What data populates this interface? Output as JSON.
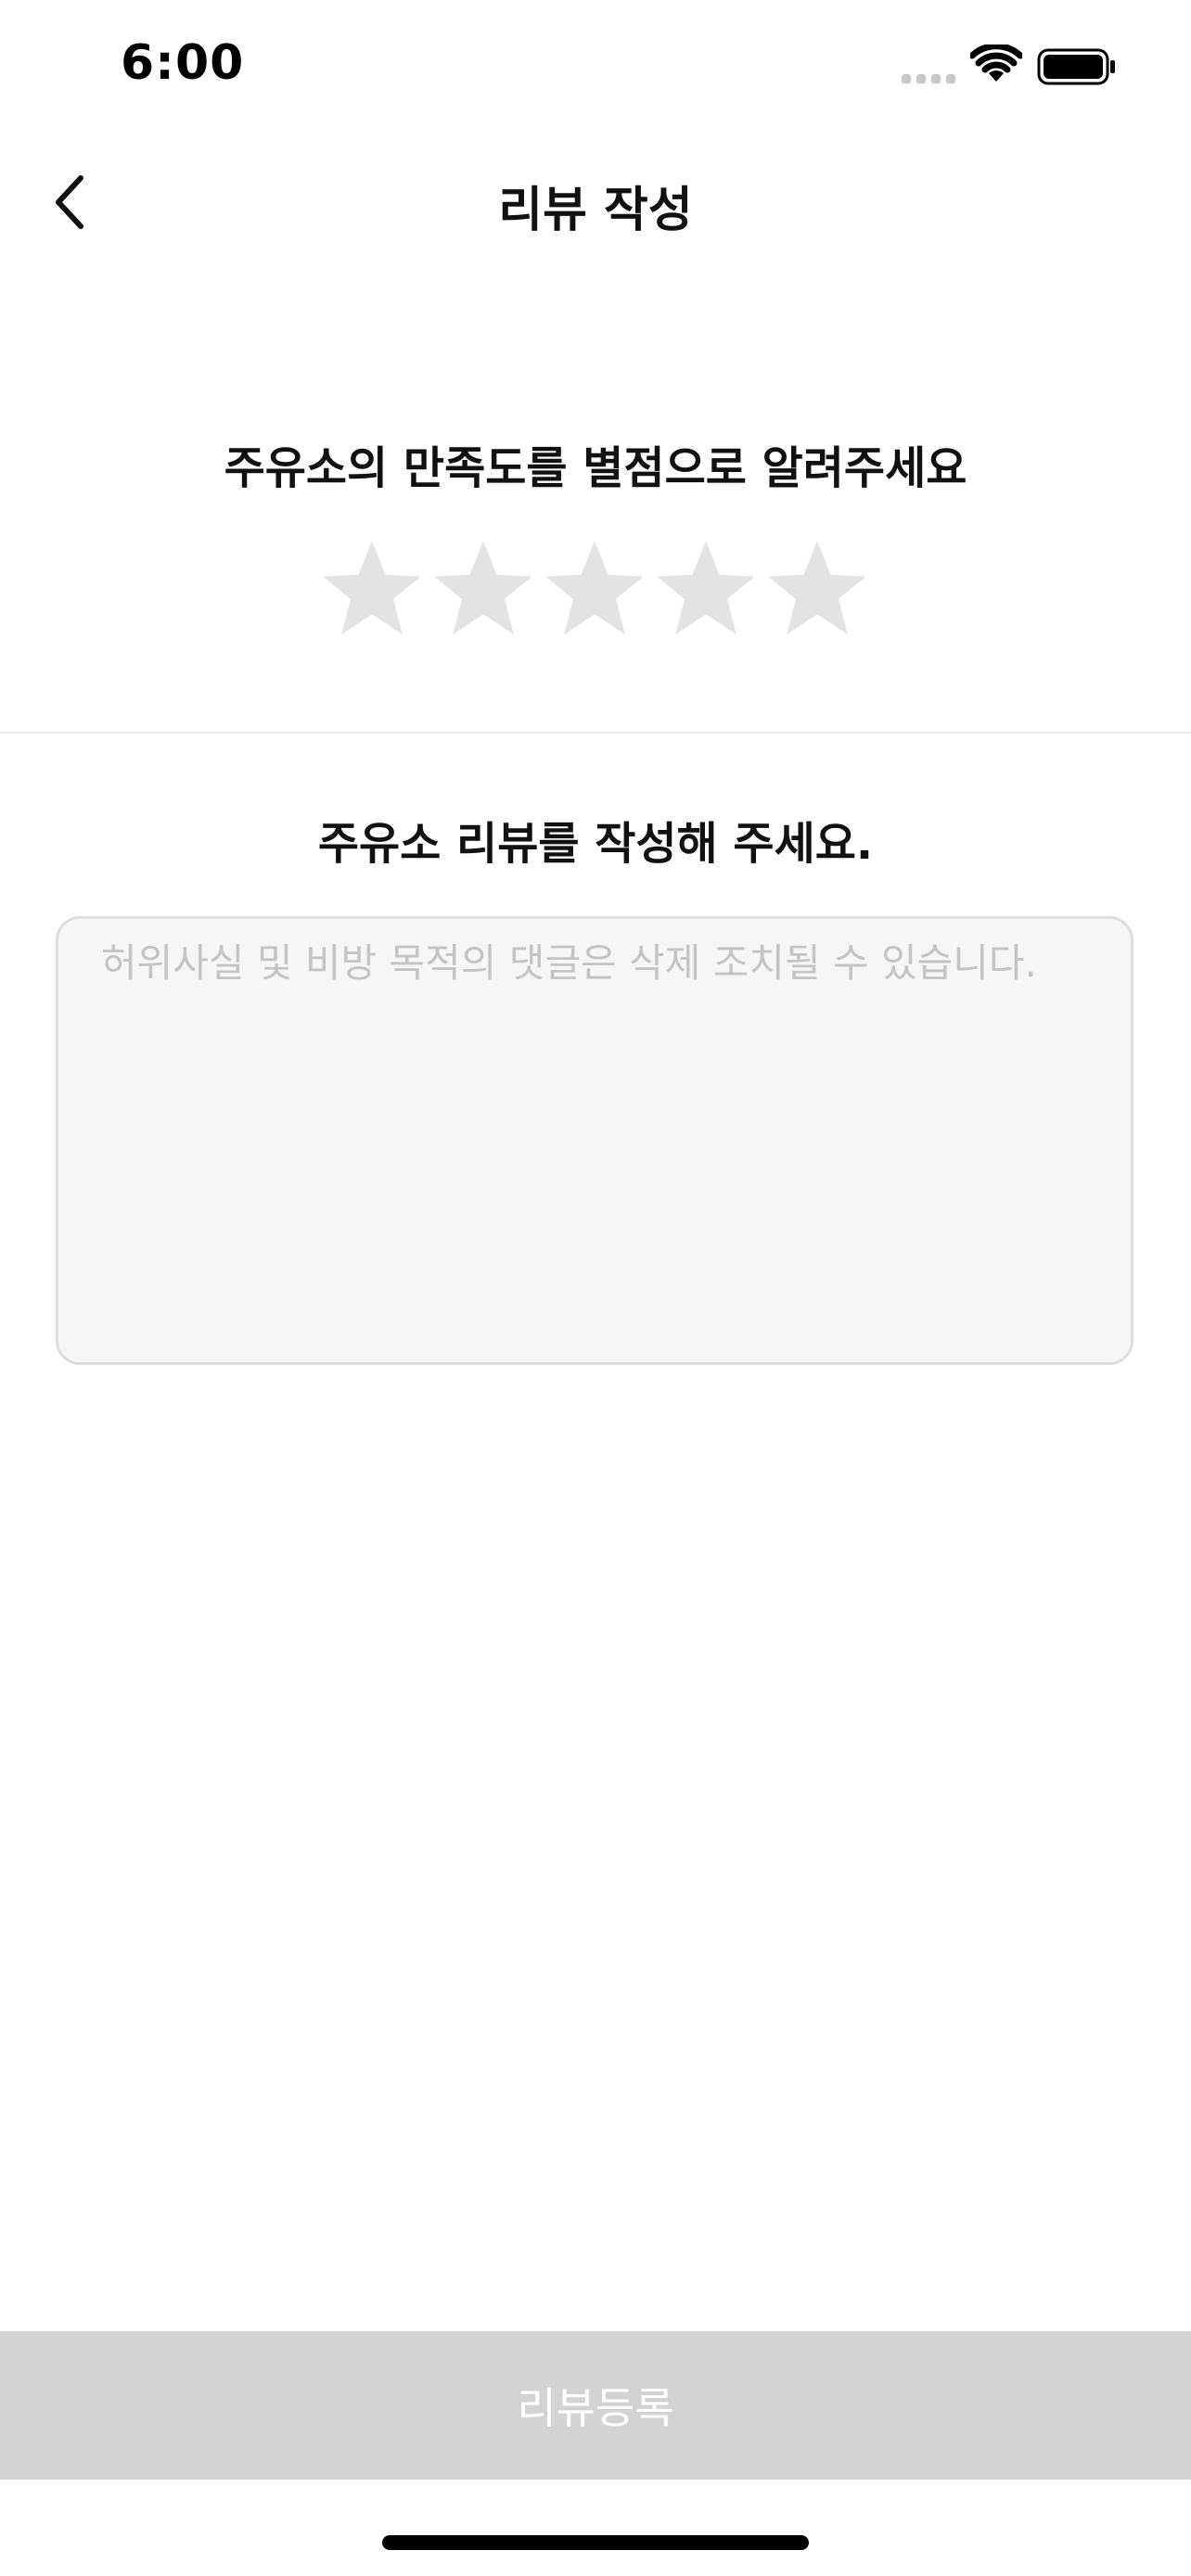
{
  "status_bar": {
    "time": "6:00",
    "icons": [
      "signal-dots-icon",
      "wifi-icon",
      "battery-icon"
    ]
  },
  "nav": {
    "title": "리뷰 작성",
    "back_icon": "chevron-left-icon"
  },
  "rating": {
    "prompt": "주유소의 만족도를 별점으로 알려주세요",
    "max_stars": 5,
    "selected_stars": 0,
    "star_icon": "star-icon",
    "empty_color": "#e3e3e3"
  },
  "review": {
    "prompt": "주유소 리뷰를 작성해 주세요.",
    "value": "",
    "placeholder": "허위사실 및 비방 목적의 댓글은 삭제 조치될 수 있습니다."
  },
  "submit": {
    "label": "리뷰등록",
    "enabled": false,
    "background": "#d3d3d3",
    "text_color": "#ffffff"
  }
}
